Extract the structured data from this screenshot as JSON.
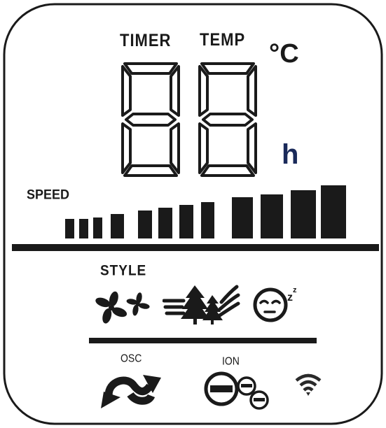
{
  "display": {
    "timer_label": "TIMER",
    "temp_label": "TEMP",
    "temp_unit": "°C",
    "hours_unit": "h",
    "digits": [
      "8",
      "8"
    ]
  },
  "speed": {
    "label": "SPEED",
    "levels": 12,
    "active_levels": 12
  },
  "style": {
    "label": "STYLE",
    "modes": [
      {
        "icon": "fan-normal-icon"
      },
      {
        "icon": "natural-wind-icon"
      },
      {
        "icon": "sleep-mode-icon"
      }
    ]
  },
  "bottom": {
    "osc_label": "OSC",
    "ion_label": "ION",
    "osc_icon": "oscillation-icon",
    "ion_icon": "ion-icon",
    "wifi_icon": "wifi-icon"
  },
  "colors": {
    "segment": "#1a1a1a",
    "background": "#ffffff"
  }
}
